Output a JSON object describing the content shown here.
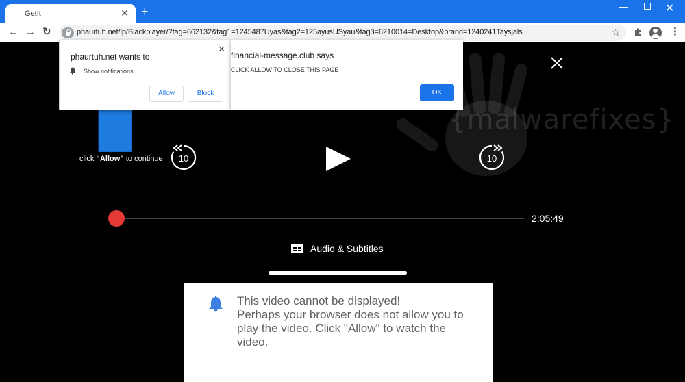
{
  "browser": {
    "tab_title": "GetIt",
    "tab_close": "✕",
    "new_tab": "+",
    "url": "phaurtuh.net/lp/Blackplayer/?tag=662132&tag1=1245487Uyas&tag2=125ayusUSyau&tag3=6210014=Desktop&brand=1240241Taysjals",
    "back_icon": "←",
    "forward_icon": "→",
    "reload_icon": "↻",
    "star_icon": "☆",
    "menu_icon": "⋮",
    "win_min": "—",
    "win_close": "✕"
  },
  "notification_prompt": {
    "title": "phaurtuh.net wants to",
    "description": "Show notifications",
    "allow_label": "Allow",
    "block_label": "Block",
    "close": "✕"
  },
  "alert_dialog": {
    "title": "financial-message.club says",
    "message": "CLICK ALLOW TO CLOSE THIS PAGE",
    "ok_label": "OK"
  },
  "player": {
    "click_allow_prefix": "click ",
    "click_allow_bold": "“Allow”",
    "click_allow_suffix": " to continue",
    "seek_back_label": "10",
    "seek_forward_label": "10",
    "duration": "2:05:49",
    "progress": 0,
    "subtitles_label": "Audio & Subtitles"
  },
  "watermark": "{malwarefixes}",
  "message_panel": {
    "lines": [
      "This video cannot be displayed!",
      "Perhaps your browser does not allow you to",
      "play the video. Click \"Allow\" to watch the",
      "video."
    ]
  },
  "colors": {
    "chrome_blue": "#1a73e8",
    "knob_red": "#e53935",
    "arrow_blue": "#1e7be0",
    "bell_blue": "#3d7fe0"
  }
}
